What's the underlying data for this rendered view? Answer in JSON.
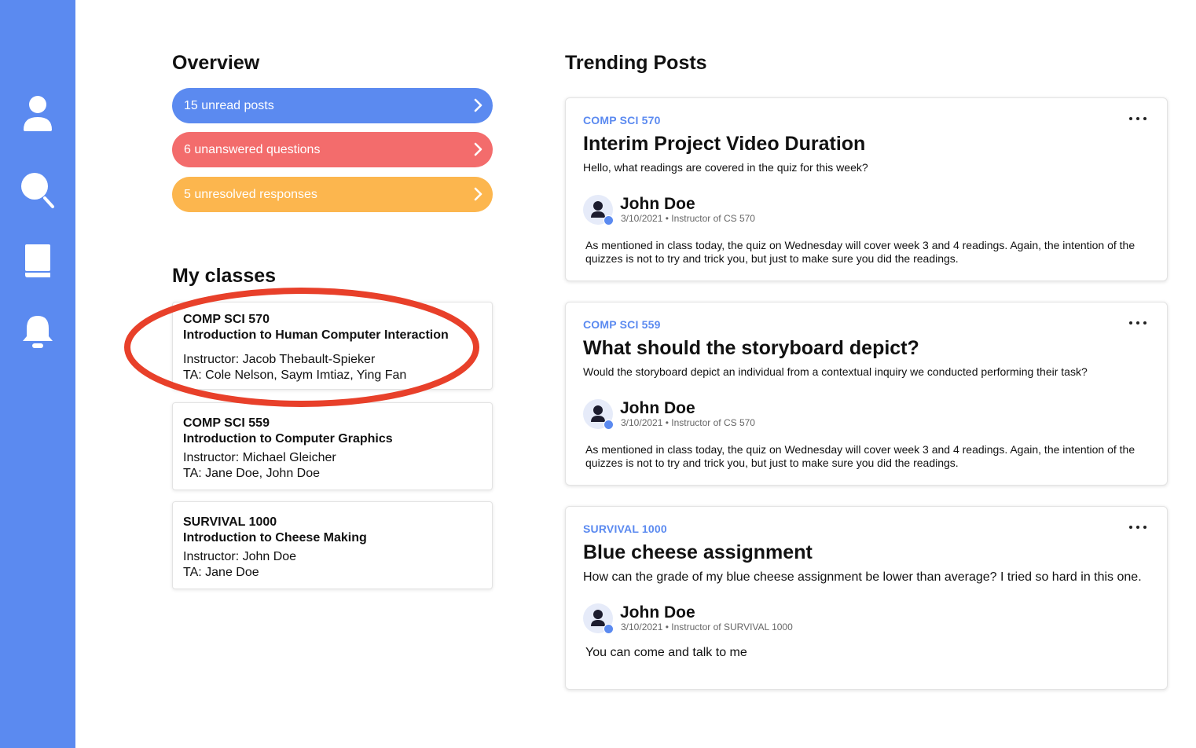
{
  "sidebar": {
    "items": [
      {
        "icon": "user-icon"
      },
      {
        "icon": "search-icon"
      },
      {
        "icon": "book-icon"
      },
      {
        "icon": "bell-icon"
      }
    ],
    "color": "#5b8af0"
  },
  "overview": {
    "title": "Overview",
    "pills": [
      {
        "label": "15 unread posts",
        "color": "#5b8af0"
      },
      {
        "label": "6 unanswered questions",
        "color": "#f36c6c"
      },
      {
        "label": "5 unresolved responses",
        "color": "#fcb64e"
      }
    ]
  },
  "classes": {
    "title": "My classes",
    "items": [
      {
        "code": "COMP SCI 570",
        "name": "Introduction to Human Computer Interaction",
        "instructor": "Instructor: Jacob Thebault-Spieker",
        "ta": "TA: Cole Nelson, Saym Imtiaz, Ying Fan",
        "highlighted": true
      },
      {
        "code": "COMP SCI 559",
        "name": "Introduction to Computer Graphics",
        "instructor": "Instructor: Michael Gleicher",
        "ta": "TA: Jane Doe, John Doe"
      },
      {
        "code": "SURVIVAL 1000",
        "name": "Introduction to Cheese Making",
        "instructor": "Instructor: John Doe",
        "ta": "TA: Jane Doe"
      }
    ],
    "highlight_color": "#e8402a"
  },
  "trending": {
    "title": "Trending Posts",
    "posts": [
      {
        "tag": "COMP SCI 570",
        "title": "Interim Project Video Duration",
        "body": "Hello, what readings are covered in the quiz for this week?",
        "author": "John Doe",
        "meta": "3/10/2021 • Instructor of CS 570",
        "reply": "As mentioned in class today, the quiz on Wednesday will cover week 3 and 4 readings. Again, the intention of the quizzes is not to try and trick you, but just to make sure you did the readings."
      },
      {
        "tag": "COMP SCI 559",
        "title": "What should the storyboard depict?",
        "body": "Would the storyboard depict an individual from a contextual inquiry we conducted performing their task?",
        "author": "John Doe",
        "meta": "3/10/2021 • Instructor of CS 570",
        "reply": "As mentioned in class today, the quiz on Wednesday will cover week 3 and 4 readings. Again, the intention of the quizzes is not to try and trick you, but just to make sure you did the readings."
      },
      {
        "tag": "SURVIVAL 1000",
        "title": "Blue cheese assignment",
        "body": "How can the grade of my blue cheese assignment be lower than average? I tried so hard in this one.",
        "author": "John Doe",
        "meta": "3/10/2021 • Instructor of SURVIVAL 1000",
        "reply": "You can come and talk to me"
      }
    ],
    "accent": "#5b8af0"
  }
}
